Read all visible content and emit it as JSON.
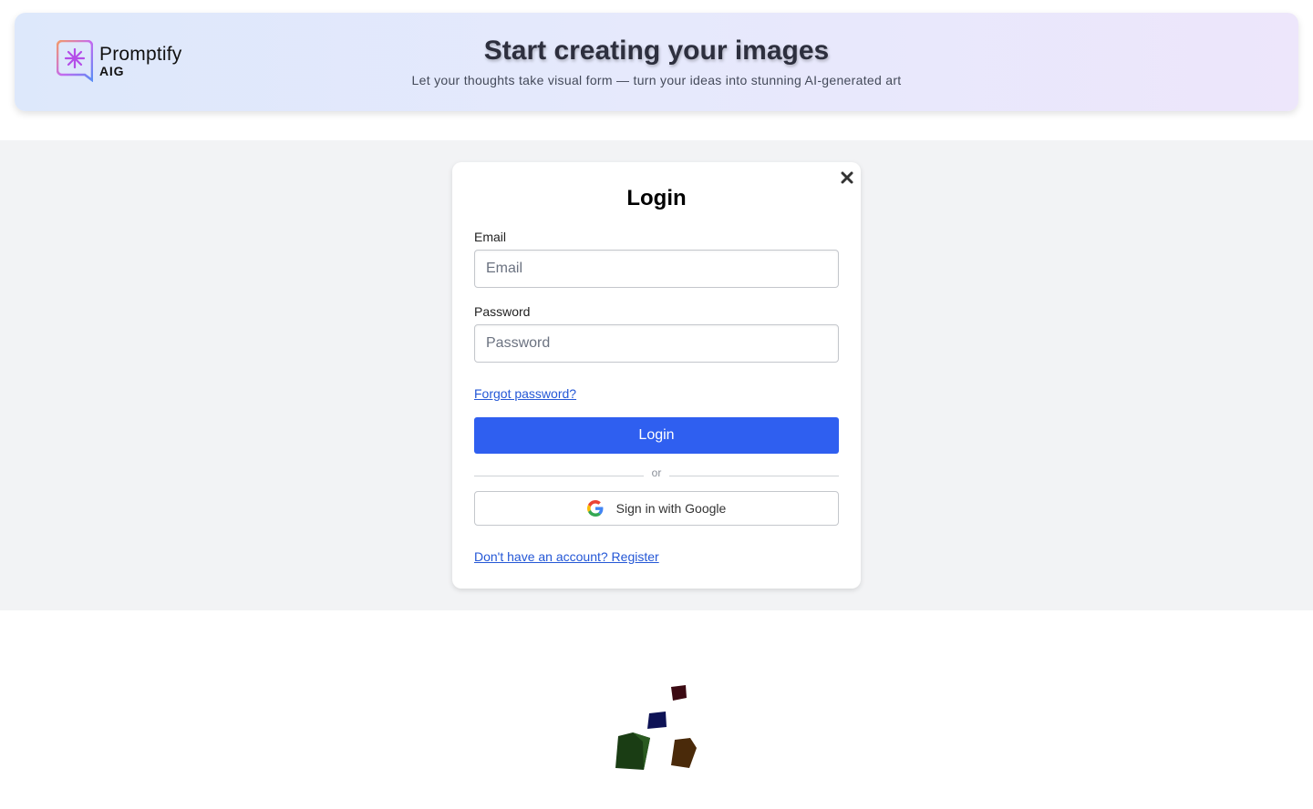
{
  "brand": {
    "name": "Promptify",
    "sub": "AIG"
  },
  "header": {
    "title": "Start creating your images",
    "subtitle": "Let your thoughts take visual form — turn your ideas into stunning AI-generated art"
  },
  "login": {
    "title": "Login",
    "email_label": "Email",
    "email_placeholder": "Email",
    "password_label": "Password",
    "password_placeholder": "Password",
    "forgot_link": "Forgot password?",
    "login_button": "Login",
    "divider_text": "or",
    "google_button": "Sign in with Google",
    "register_link": "Don't have an account? Register"
  },
  "colors": {
    "primary": "#2f5ff0",
    "link": "#2457d6",
    "cube_red": "#3b0a12",
    "cube_blue": "#0d1255",
    "cube_green": "#1a3d14",
    "cube_brown": "#4a2a0a"
  },
  "icons": [
    "promptify-logo-icon",
    "close-icon",
    "google-g-icon"
  ]
}
